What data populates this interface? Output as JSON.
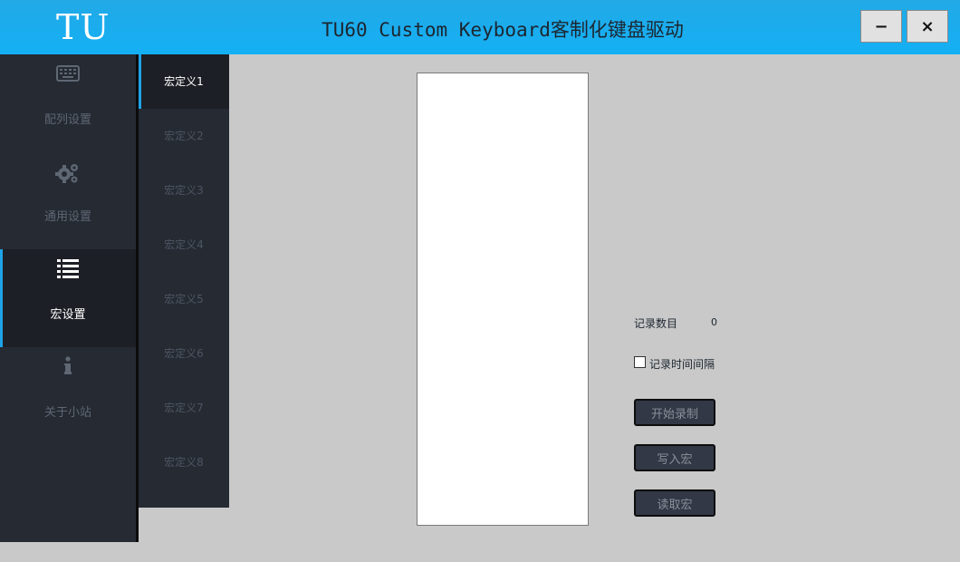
{
  "app": {
    "logo": "TU",
    "title": "TU60 Custom Keyboard客制化键盘驱动",
    "minimize_label": "−",
    "close_label": "×"
  },
  "sidebar": {
    "items": [
      {
        "label": "配列设置",
        "icon": "keyboard-icon"
      },
      {
        "label": "通用设置",
        "icon": "gears-icon"
      },
      {
        "label": "宏设置",
        "icon": "list-icon",
        "active": true
      },
      {
        "label": "关于小站",
        "icon": "info-icon"
      }
    ]
  },
  "subnav": {
    "items": [
      "宏定义1",
      "宏定义2",
      "宏定义3",
      "宏定义4",
      "宏定义5",
      "宏定义6",
      "宏定义7",
      "宏定义8"
    ],
    "active_index": 0
  },
  "panel": {
    "record_count_label": "记录数目",
    "record_count_value": "0",
    "record_interval_label": "记录时间间隔",
    "record_interval_checked": false,
    "start_record_label": "开始录制",
    "write_macro_label": "写入宏",
    "read_macro_label": "读取宏"
  },
  "colors": {
    "titlebar": "#14b0f5",
    "sidebar": "#252a33",
    "sidebar_active": "#1c1f25",
    "accent": "#1fa3e8",
    "content_bg": "#c9c9c9"
  }
}
